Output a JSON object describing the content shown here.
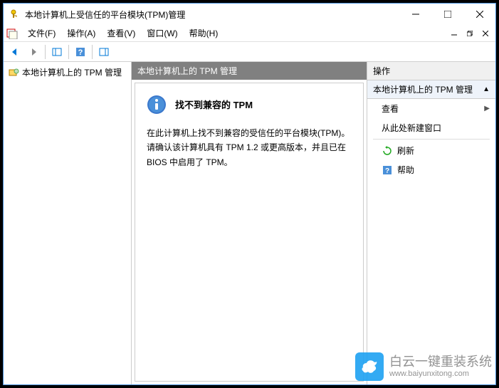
{
  "window": {
    "title": "本地计算机上受信任的平台模块(TPM)管理"
  },
  "menubar": {
    "items": [
      {
        "label": "文件(F)"
      },
      {
        "label": "操作(A)"
      },
      {
        "label": "查看(V)"
      },
      {
        "label": "窗口(W)"
      },
      {
        "label": "帮助(H)"
      }
    ]
  },
  "tree": {
    "root": "本地计算机上的 TPM 管理"
  },
  "center": {
    "header": "本地计算机上的 TPM 管理",
    "heading": "找不到兼容的 TPM",
    "body": "在此计算机上找不到兼容的受信任的平台模块(TPM)。请确认该计算机具有 TPM 1.2 或更高版本，并且已在 BIOS 中启用了 TPM。"
  },
  "actions": {
    "header": "操作",
    "section": "本地计算机上的 TPM 管理",
    "items": [
      {
        "label": "查看",
        "has_submenu": true
      },
      {
        "label": "从此处新建窗口"
      },
      {
        "label": "刷新",
        "icon": "refresh"
      },
      {
        "label": "帮助",
        "icon": "help"
      }
    ]
  },
  "watermark": {
    "brand": "白云一键重装系统",
    "url": "www.baiyunxitong.com"
  }
}
